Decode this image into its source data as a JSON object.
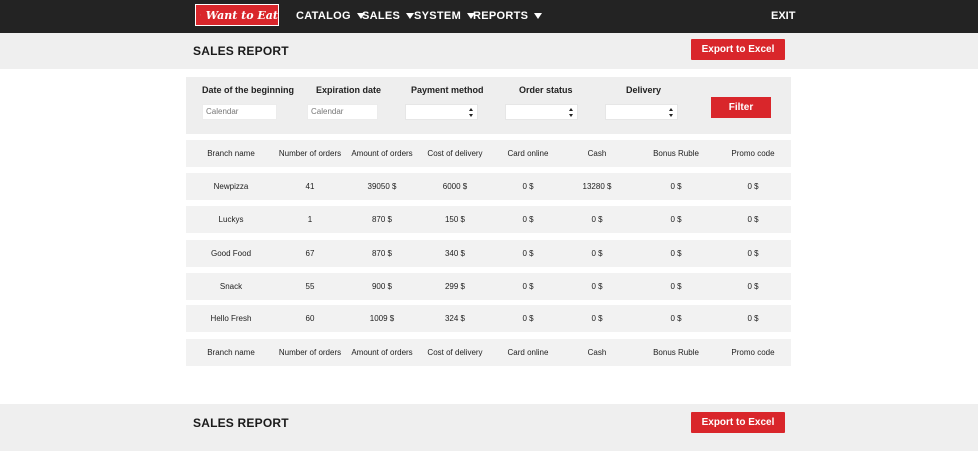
{
  "navbar": {
    "logo_text": "Want to Eat",
    "menu": [
      {
        "label": "CATALOG"
      },
      {
        "label": "SALES"
      },
      {
        "label": "SYSTEM"
      },
      {
        "label": "REPORTS"
      }
    ],
    "exit_label": "EXIT"
  },
  "report_header": {
    "title": "SALES REPORT",
    "export_label": "Export to Excel"
  },
  "filters": {
    "date_begin_label": "Date of the beginning",
    "date_begin_placeholder": "Calendar",
    "expiration_label": "Expiration date",
    "expiration_placeholder": "Calendar",
    "payment_label": "Payment method",
    "status_label": "Order status",
    "delivery_label": "Delivery",
    "filter_button": "Filter"
  },
  "table": {
    "columns": [
      "Branch name",
      "Number of orders",
      "Amount of orders",
      "Cost of delivery",
      "Card online",
      "Cash",
      "Bonus Ruble",
      "Promo code"
    ],
    "rows": [
      [
        "Newpizza",
        "41",
        "39050 $",
        "6000 $",
        "0 $",
        "13280 $",
        "0 $",
        "0 $"
      ],
      [
        "Luckys",
        "1",
        "870 $",
        "150 $",
        "0 $",
        "0 $",
        "0 $",
        "0 $"
      ],
      [
        "Good Food",
        "67",
        "870 $",
        "340 $",
        "0 $",
        "0 $",
        "0 $",
        "0 $"
      ],
      [
        "Snack",
        "55",
        "900 $",
        "299 $",
        "0 $",
        "0 $",
        "0 $",
        "0 $"
      ],
      [
        "Hello Fresh",
        "60",
        "1009 $",
        "324 $",
        "0 $",
        "0 $",
        "0 $",
        "0 $"
      ]
    ]
  },
  "footer_report": {
    "title": "SALES REPORT",
    "export_label": "Export to Excel"
  },
  "colors": {
    "navbar_bg": "#232323",
    "accent_red": "#d9262b",
    "panel_gray": "#eeeeee"
  }
}
